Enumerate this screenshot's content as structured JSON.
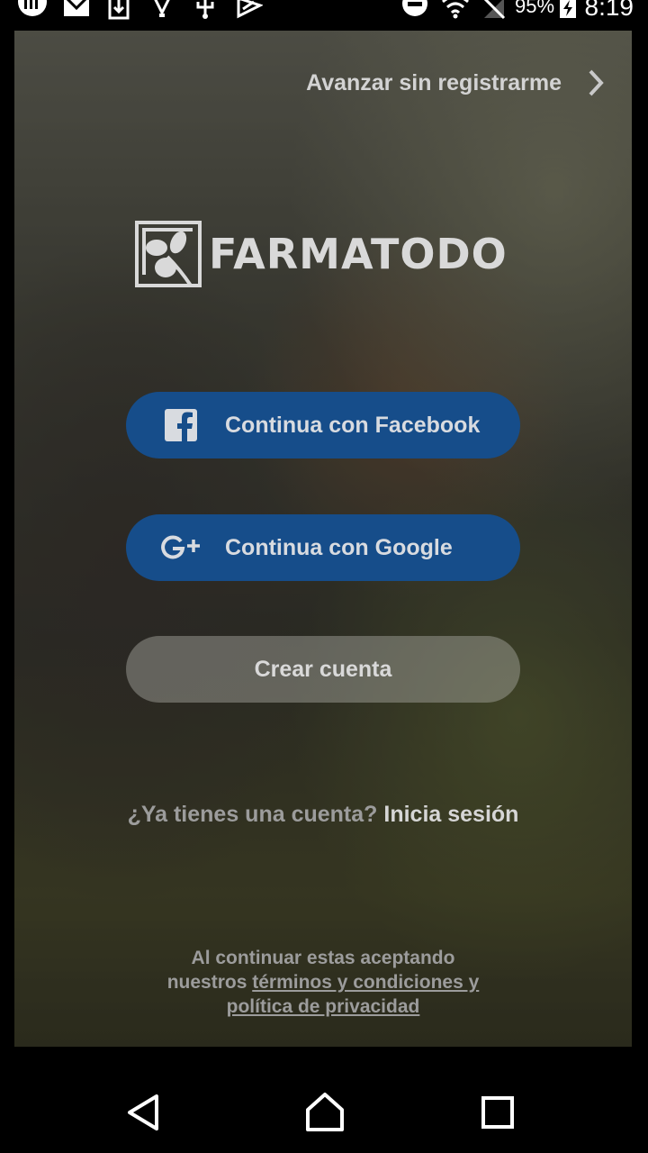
{
  "status_bar": {
    "battery_percent": "95%",
    "time": "8:19",
    "icons": [
      "voicemail-icon",
      "gmail-icon",
      "download-icon",
      "lightbulb-icon",
      "usb-icon",
      "play-store-icon",
      "do-not-disturb-icon",
      "wifi-icon",
      "no-signal-icon",
      "battery-charging-icon"
    ]
  },
  "skip": {
    "label": "Avanzar sin registrarme",
    "icon": "chevron-right-icon"
  },
  "logo": {
    "text": "FARMATODO",
    "icon": "clover-icon"
  },
  "buttons": {
    "facebook": "Continua con Facebook",
    "google": "Continua con Google",
    "create_account": "Crear cuenta"
  },
  "login": {
    "question": "¿Ya tienes una cuenta?",
    "link": "Inicia sesión"
  },
  "legal": {
    "line1": "Al continuar estas aceptando",
    "prefix": "nuestros",
    "terms": "términos y condiciones y",
    "privacy": "política de privacidad"
  },
  "colors": {
    "social_button": "#164d8a",
    "overlay_text": "#d3d3d3"
  },
  "navigation": [
    "back-icon",
    "home-icon",
    "recents-icon"
  ]
}
